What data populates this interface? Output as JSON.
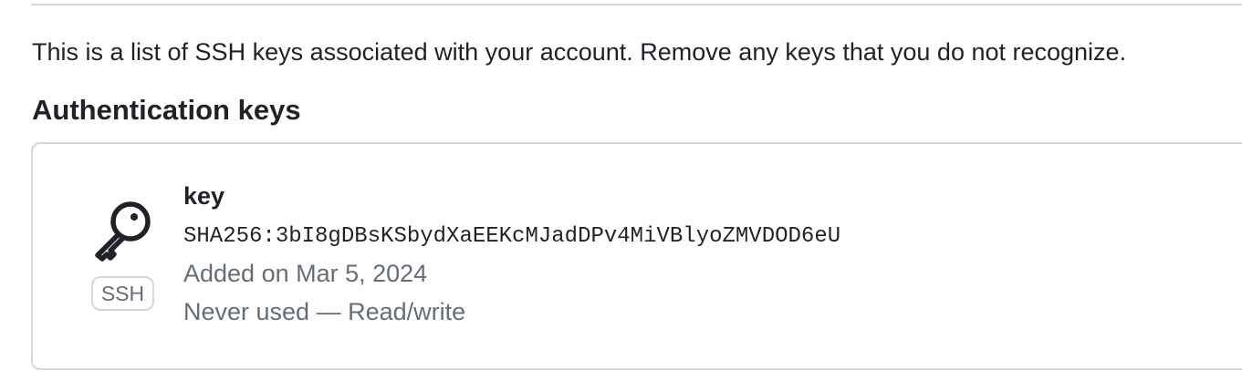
{
  "intro_text": "This is a list of SSH keys associated with your account. Remove any keys that you do not recognize.",
  "section_title": "Authentication keys",
  "keys": [
    {
      "icon": "key-icon",
      "badge": "SSH",
      "title": "key",
      "fingerprint": "SHA256:3bI8gDBsKSbydXaEEKcMJadDPv4MiVBlyoZMVDOD6eU",
      "added": "Added on Mar 5, 2024",
      "usage": "Never used — Read/write"
    }
  ],
  "colors": {
    "text": "#1f2328",
    "muted": "#656d76",
    "border": "#d0d7de"
  }
}
